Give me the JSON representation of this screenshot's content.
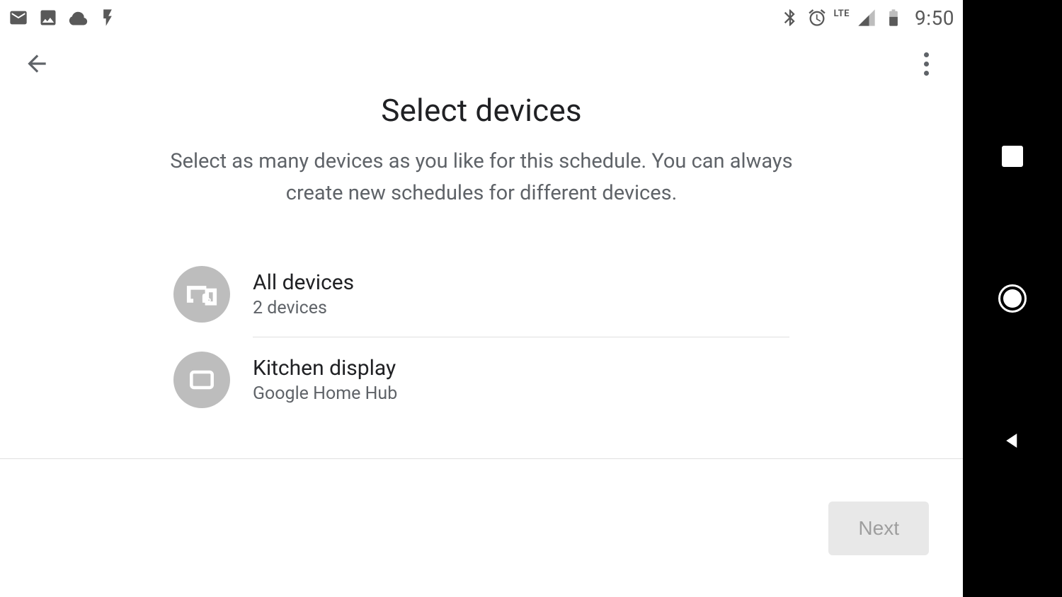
{
  "status": {
    "clock": "9:50",
    "network": "LTE"
  },
  "appbar": {
    "back": "Back",
    "overflow": "More options"
  },
  "page": {
    "title": "Select devices",
    "subtitle": "Select as many devices as you like for this schedule. You can always create new schedules for different devices."
  },
  "devices": [
    {
      "title": "All devices",
      "subtitle": "2 devices",
      "icon": "devices-group"
    },
    {
      "title": "Kitchen display",
      "subtitle": "Google Home Hub",
      "icon": "display"
    }
  ],
  "footer": {
    "next": "Next"
  }
}
